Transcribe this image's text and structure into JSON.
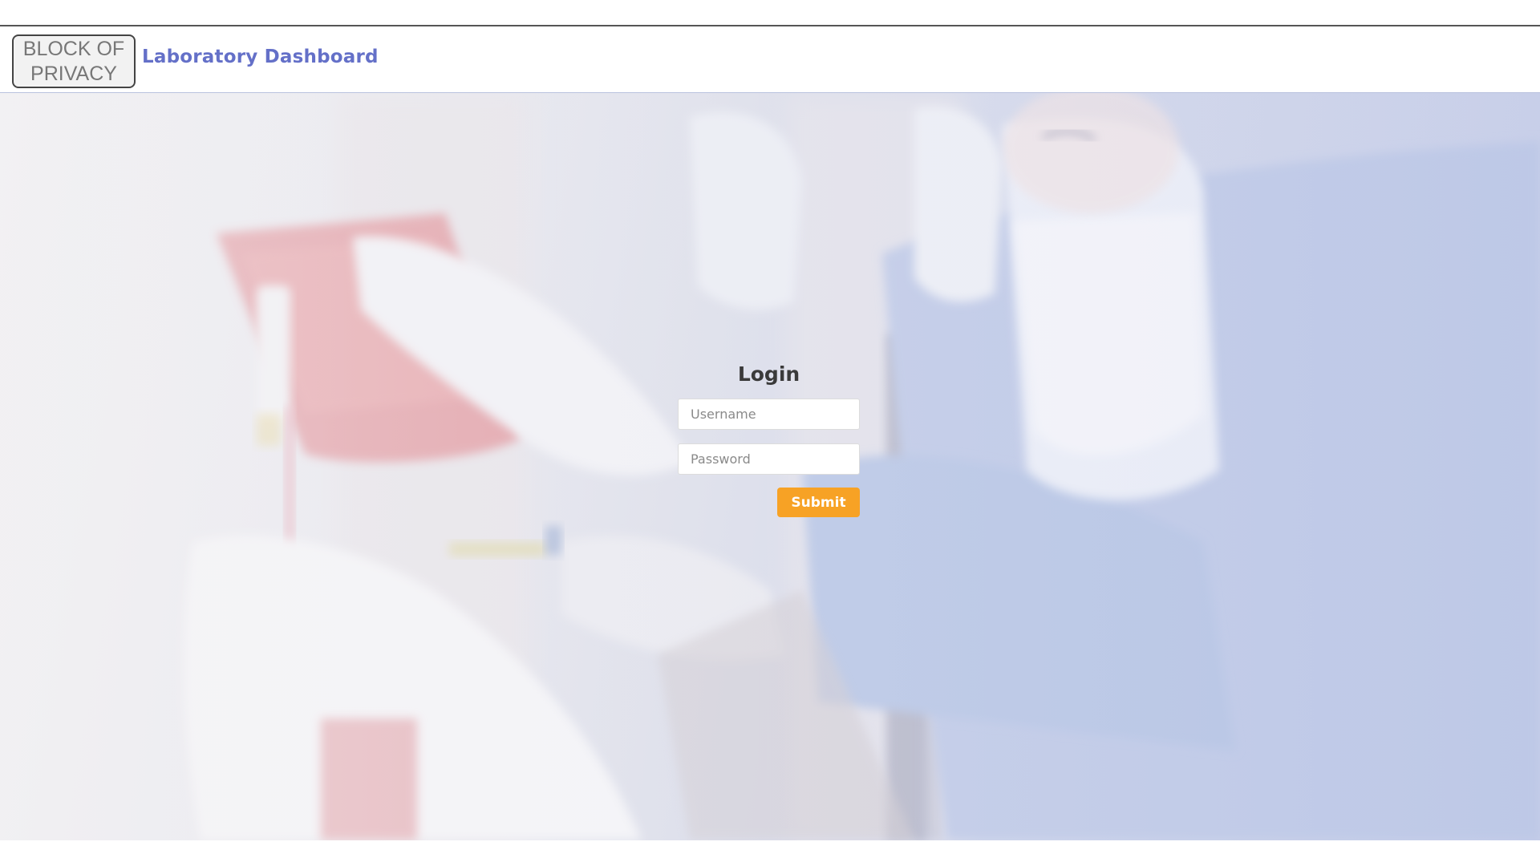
{
  "header": {
    "logo_text": "BLOCK OF PRIVACY",
    "logo_line1": "BLOCK OF",
    "logo_line2": "PRIVACY",
    "title": "Laboratory Dashboard"
  },
  "hero": {
    "image": "laboratory-scientist-photo",
    "tint": "#c9d0ec"
  },
  "login": {
    "title": "Login",
    "username_placeholder": "Username",
    "username_value": "",
    "password_placeholder": "Password",
    "password_value": "",
    "submit_label": "Submit"
  },
  "colors": {
    "brand": "#6470c8",
    "accent": "#f7a225",
    "text_dark": "#3a3a3a"
  }
}
